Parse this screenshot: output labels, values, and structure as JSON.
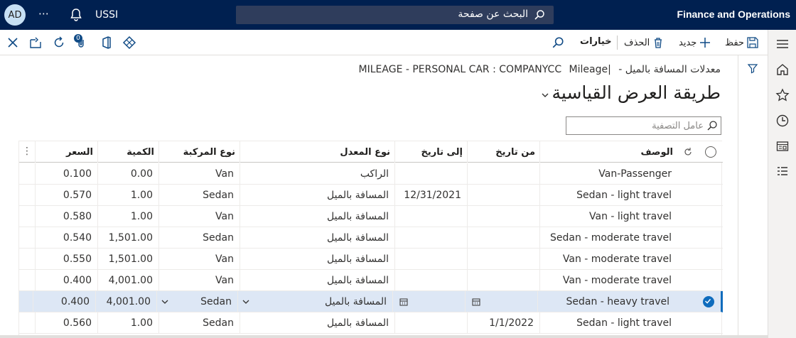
{
  "topbar": {
    "avatar_initials": "AD",
    "more_label": "⋯",
    "company": "USSI",
    "search_placeholder": "البحث عن صفحة",
    "app_name": "Finance and Operations"
  },
  "actionpane": {
    "save_label": "حفظ",
    "new_label": "جديد",
    "delete_label": "الحذف",
    "options_label": "خيارات",
    "attachments_count": "0"
  },
  "page": {
    "breadcrumb_prefix": "معدلات المسافة بالميل -",
    "breadcrumb_record": "|MILEAGE - PERSONAL CAR : COMPANYCC",
    "breadcrumb_suffix": "Mileage",
    "title": "طريقة العرض القياسية",
    "filter_placeholder": "عامل التصفية"
  },
  "grid": {
    "headers": {
      "description": "الوصف",
      "from_date": "من تاريخ",
      "to_date": "إلى تاريخ",
      "rate_type": "نوع المعدل",
      "vehicle_type": "نوع المركبة",
      "quantity": "الكمية",
      "price": "السعر"
    },
    "rows": [
      {
        "description": "Van-Passenger",
        "from_date": "",
        "to_date": "",
        "rate_type": "الراكب",
        "vehicle_type": "Van",
        "quantity": "0.00",
        "price": "0.100",
        "selected": false
      },
      {
        "description": "Sedan - light travel",
        "from_date": "",
        "to_date": "12/31/2021",
        "rate_type": "المسافة بالميل",
        "vehicle_type": "Sedan",
        "quantity": "1.00",
        "price": "0.570",
        "selected": false
      },
      {
        "description": "Van - light travel",
        "from_date": "",
        "to_date": "",
        "rate_type": "المسافة بالميل",
        "vehicle_type": "Van",
        "quantity": "1.00",
        "price": "0.580",
        "selected": false
      },
      {
        "description": "Sedan - moderate travel",
        "from_date": "",
        "to_date": "",
        "rate_type": "المسافة بالميل",
        "vehicle_type": "Sedan",
        "quantity": "1,501.00",
        "price": "0.540",
        "selected": false
      },
      {
        "description": "Van - moderate travel",
        "from_date": "",
        "to_date": "",
        "rate_type": "المسافة بالميل",
        "vehicle_type": "Van",
        "quantity": "1,501.00",
        "price": "0.550",
        "selected": false
      },
      {
        "description": "Van - moderate travel",
        "from_date": "",
        "to_date": "",
        "rate_type": "المسافة بالميل",
        "vehicle_type": "Van",
        "quantity": "4,001.00",
        "price": "0.400",
        "selected": false
      },
      {
        "description": "Sedan - heavy travel",
        "from_date": "",
        "to_date": "",
        "rate_type": "المسافة بالميل",
        "vehicle_type": "Sedan",
        "quantity": "4,001.00",
        "price": "0.400",
        "selected": true
      },
      {
        "description": "Sedan - light travel",
        "from_date": "1/1/2022",
        "to_date": "",
        "rate_type": "المسافة بالميل",
        "vehicle_type": "Sedan",
        "quantity": "1.00",
        "price": "0.560",
        "selected": false
      }
    ]
  },
  "colors": {
    "topbar_bg": "#002050",
    "accent": "#0f6cbd",
    "selected_row": "#dde7f5"
  }
}
